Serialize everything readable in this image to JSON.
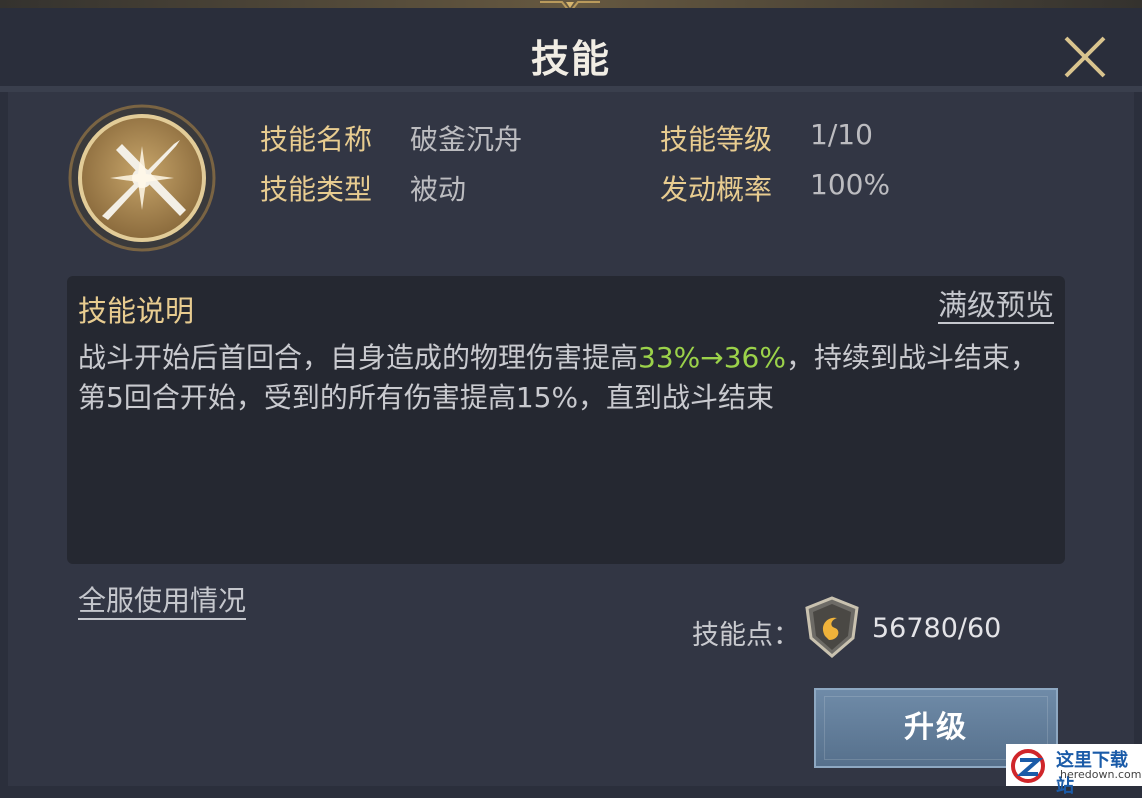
{
  "window": {
    "title": "技能"
  },
  "skill": {
    "name_label": "技能名称",
    "name_value": "破釜沉舟",
    "type_label": "技能类型",
    "type_value": "被动",
    "level_label": "技能等级",
    "level_value": "1/10",
    "rate_label": "发动概率",
    "rate_value": "100%"
  },
  "description": {
    "title": "技能说明",
    "preview_link": "满级预览",
    "text_part1": "战斗开始后首回合，自身造成的物理伤害提高",
    "text_highlight": "33%→36%",
    "text_part2": "，持续到战斗结束，第5回合开始，受到的所有伤害提高15%，直到战斗结束"
  },
  "server_usage_link": "全服使用情况",
  "points": {
    "label": "技能点：",
    "value": "56780/60"
  },
  "upgrade_button": "升级",
  "watermark": {
    "cn": "这里下载站",
    "en": "heredown.com"
  },
  "colors": {
    "accent_gold": "#e8cc90",
    "highlight_green": "#9bd24a"
  },
  "icons": [
    "close-icon",
    "crossed-swords-icon",
    "skill-point-shield-icon"
  ]
}
